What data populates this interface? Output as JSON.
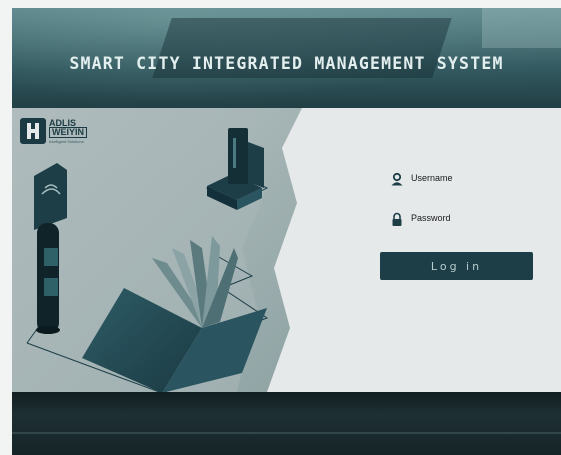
{
  "app": {
    "title": "SMART CITY INTEGRATED MANAGEMENT SYSTEM"
  },
  "logo": {
    "line1": "ADLIS",
    "line2": "WEIYIN",
    "tagline": "Intelligent Solutions"
  },
  "login": {
    "username_label": "Username",
    "password_label": "Password",
    "button_label": "Log in"
  },
  "icons": {
    "username": "user-icon",
    "password": "lock-icon"
  },
  "colors": {
    "accent": "#1d3e47",
    "panel": "#e6e9e9",
    "title": "#e3eeee"
  }
}
